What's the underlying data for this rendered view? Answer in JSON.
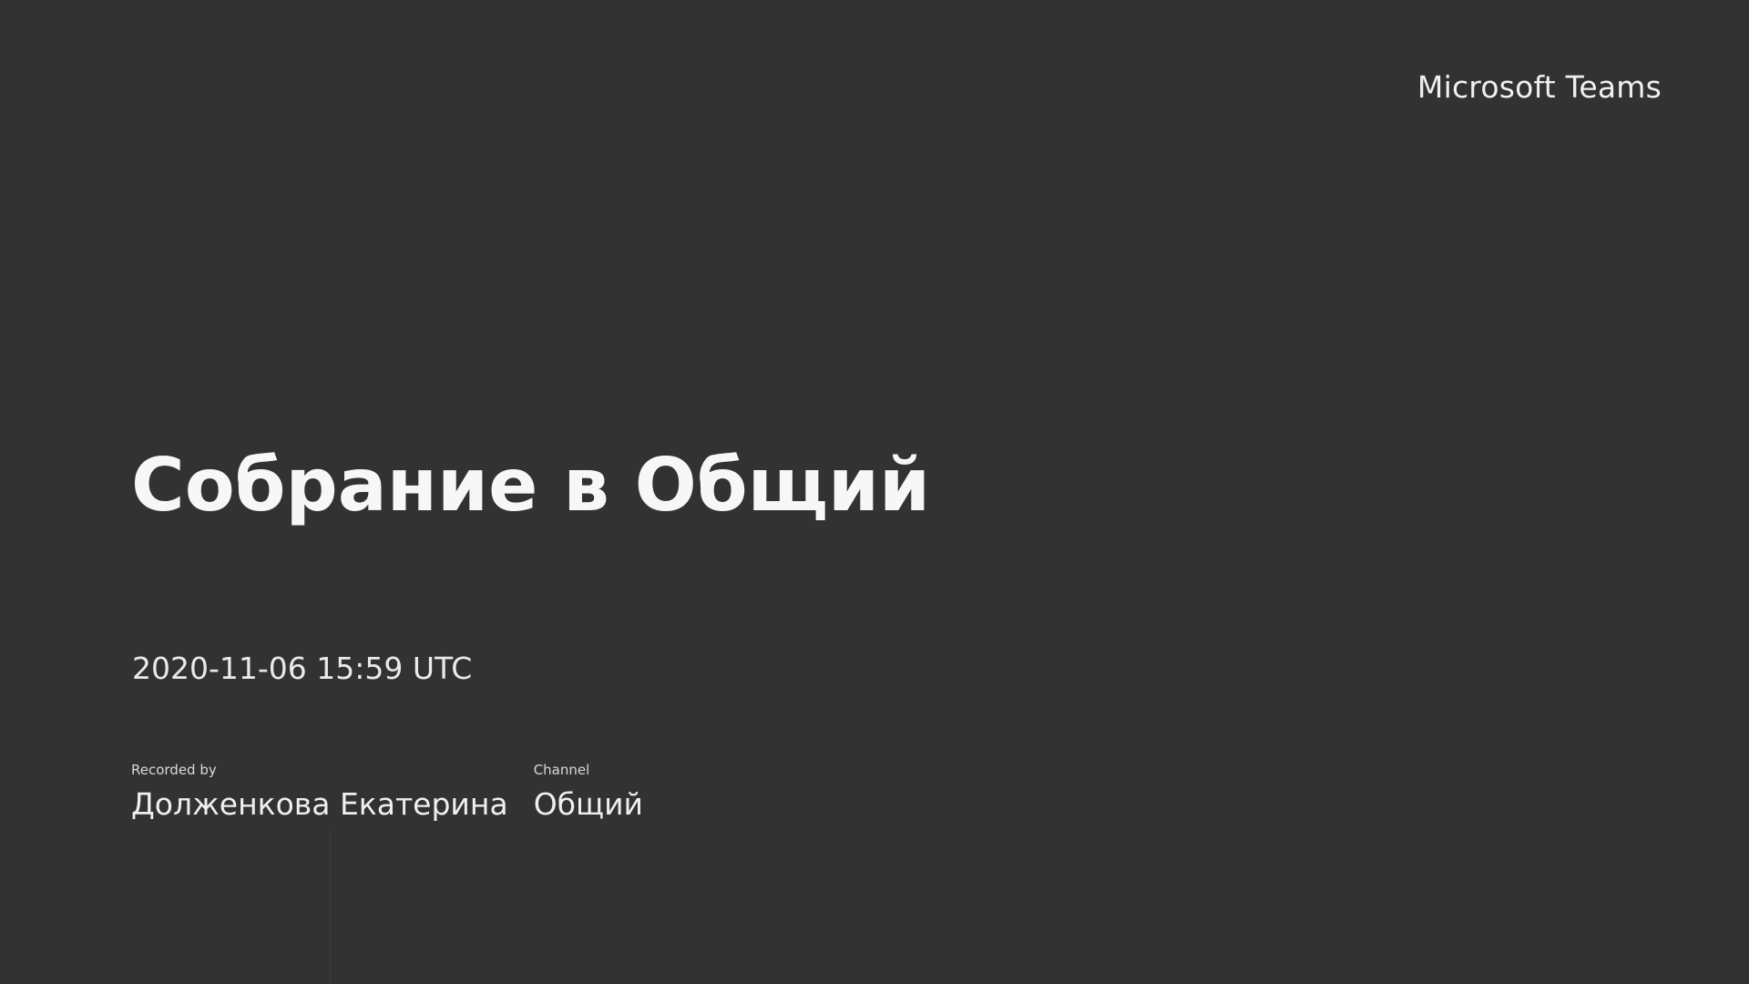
{
  "header": {
    "brand": "Microsoft Teams"
  },
  "meeting": {
    "title": "Собрание в Общий",
    "timestamp": "2020-11-06 15:59 UTC"
  },
  "details": {
    "recorded_by_label": "Recorded by",
    "recorded_by_value": "Долженкова Екатерина",
    "channel_label": "Channel",
    "channel_value": "Общий"
  },
  "colors": {
    "background": "#323232",
    "text": "#f2f2f2"
  }
}
